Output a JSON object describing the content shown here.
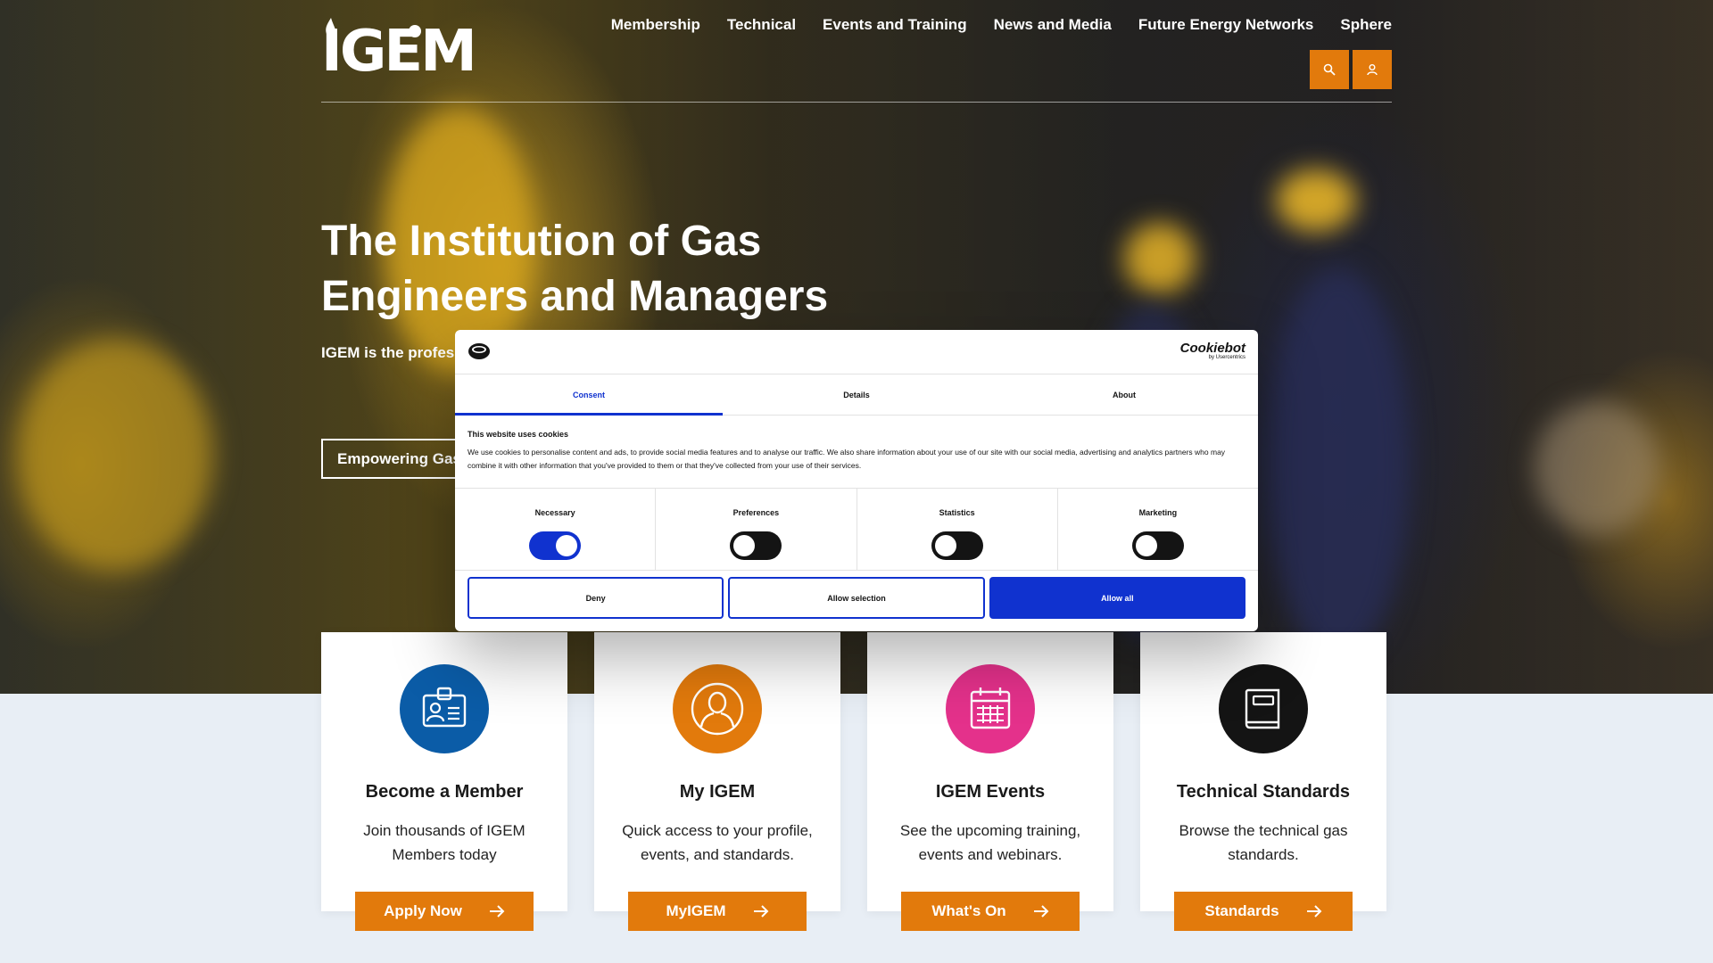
{
  "brand": {
    "logo_text": "IGEM",
    "accent": "#e27a0c"
  },
  "nav": {
    "items": [
      "Membership",
      "Technical",
      "Events and Training",
      "News and Media",
      "Future Energy Networks",
      "Sphere"
    ],
    "search_icon": "search-icon",
    "account_icon": "user-icon"
  },
  "hero": {
    "title": "The Institution of Gas Engineers and Managers",
    "text": "IGEM is the professi supporting individu safety, and drive inn",
    "cta": "Empowering Gas"
  },
  "cards": [
    {
      "title": "Become a Member",
      "text": "Join thousands of IGEM Members today",
      "button": "Apply Now",
      "icon": "id-badge-icon",
      "color": "#0b5ca7"
    },
    {
      "title": "My IGEM",
      "text": "Quick access to your profile, events, and standards.",
      "button": "MyIGEM",
      "icon": "user-circle-icon",
      "color": "#e27a0c"
    },
    {
      "title": "IGEM Events",
      "text": "See the upcoming training, events and webinars.",
      "button": "What's On",
      "icon": "calendar-icon",
      "color": "#e4318b"
    },
    {
      "title": "Technical Standards",
      "text": "Browse the technical gas standards.",
      "button": "Standards",
      "icon": "book-icon",
      "color": "#141414"
    }
  ],
  "cookie": {
    "brand": "Cookiebot",
    "brand_sub": "by Usercentrics",
    "tabs": [
      "Consent",
      "Details",
      "About"
    ],
    "active_tab": "Consent",
    "heading": "This website uses cookies",
    "body": "We use cookies to personalise content and ads, to provide social media features and to analyse our traffic. We also share information about your use of our site with our social media, advertising and analytics partners who may combine it with other information that you've provided to them or that they've collected from your use of their services.",
    "toggles": [
      {
        "label": "Necessary",
        "on": true
      },
      {
        "label": "Preferences",
        "on": false
      },
      {
        "label": "Statistics",
        "on": false
      },
      {
        "label": "Marketing",
        "on": false
      }
    ],
    "buttons": {
      "deny": "Deny",
      "allow_selection": "Allow selection",
      "allow_all": "Allow all"
    },
    "primary_color": "#1032cf"
  }
}
